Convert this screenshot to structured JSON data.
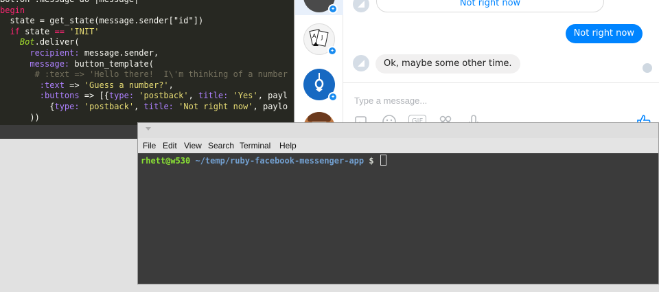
{
  "editor": {
    "lines": [
      [
        {
          "t": "Bot.on :message do |message|",
          "c": ""
        }
      ],
      [
        {
          "t": "begin",
          "c": "kw"
        }
      ],
      [
        {
          "t": "  state = get_state(message.sender[\"id\"])",
          "c": ""
        }
      ],
      [
        {
          "t": "  ",
          "c": ""
        },
        {
          "t": "if",
          "c": "kw"
        },
        {
          "t": " state ",
          "c": ""
        },
        {
          "t": "==",
          "c": "kw"
        },
        {
          "t": " ",
          "c": ""
        },
        {
          "t": "'INIT'",
          "c": "str"
        }
      ],
      [
        {
          "t": "    ",
          "c": ""
        },
        {
          "t": "Bot",
          "c": "cls"
        },
        {
          "t": ".deliver(",
          "c": ""
        }
      ],
      [
        {
          "t": "      ",
          "c": ""
        },
        {
          "t": "recipient:",
          "c": "sym"
        },
        {
          "t": " message.sender,",
          "c": ""
        }
      ],
      [
        {
          "t": "      ",
          "c": ""
        },
        {
          "t": "message:",
          "c": "sym"
        },
        {
          "t": " button_template(",
          "c": ""
        }
      ],
      [
        {
          "t": "       ",
          "c": ""
        },
        {
          "t": "# :text => 'Hello there!  I\\'m thinking of a number",
          "c": "cmt"
        }
      ],
      [
        {
          "t": "        ",
          "c": ""
        },
        {
          "t": ":text",
          "c": "sym"
        },
        {
          "t": " => ",
          "c": ""
        },
        {
          "t": "'Guess a number?'",
          "c": "str"
        },
        {
          "t": ",",
          "c": ""
        }
      ],
      [
        {
          "t": "        ",
          "c": ""
        },
        {
          "t": ":buttons",
          "c": "sym"
        },
        {
          "t": " => [{",
          "c": ""
        },
        {
          "t": "type:",
          "c": "sym"
        },
        {
          "t": " ",
          "c": ""
        },
        {
          "t": "'postback'",
          "c": "str"
        },
        {
          "t": ", ",
          "c": ""
        },
        {
          "t": "title:",
          "c": "sym"
        },
        {
          "t": " ",
          "c": ""
        },
        {
          "t": "'Yes'",
          "c": "str"
        },
        {
          "t": ", payl",
          "c": ""
        }
      ],
      [
        {
          "t": "          {",
          "c": ""
        },
        {
          "t": "type:",
          "c": "sym"
        },
        {
          "t": " ",
          "c": ""
        },
        {
          "t": "'postback'",
          "c": "str"
        },
        {
          "t": ", ",
          "c": ""
        },
        {
          "t": "title:",
          "c": "sym"
        },
        {
          "t": " ",
          "c": ""
        },
        {
          "t": "'Not right now'",
          "c": "str"
        },
        {
          "t": ", paylo",
          "c": ""
        }
      ],
      [
        {
          "t": "      ))",
          "c": ""
        }
      ]
    ]
  },
  "messenger": {
    "messages": {
      "button_option": "Not right now",
      "outgoing": "Not right now",
      "incoming": "Ok, maybe some other time."
    },
    "composer": {
      "placeholder": "Type a message..."
    },
    "tools": {
      "gif": "GIF"
    },
    "colors": {
      "accent": "#0084ff",
      "incoming_bg": "#f1f0f0"
    }
  },
  "terminal": {
    "menu": [
      "File",
      "Edit",
      "View",
      "Search",
      "Terminal",
      "Help"
    ],
    "prompt": {
      "user": "rhett@w530",
      "path": "~/temp/ruby-facebook-messenger-app",
      "symbol": "$"
    },
    "colors": {
      "user": "#8ae234",
      "path": "#729fcf"
    }
  }
}
